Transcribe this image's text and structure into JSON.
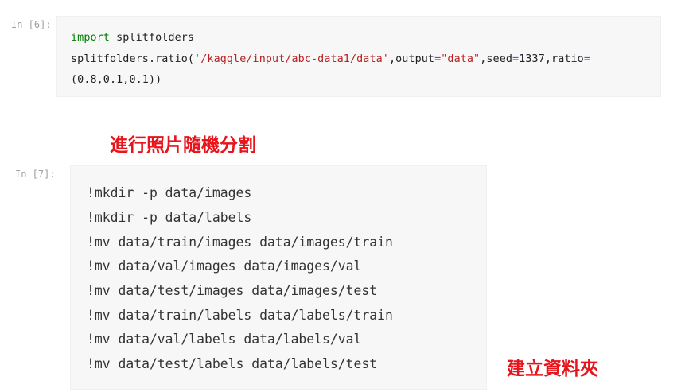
{
  "cells": [
    {
      "prompt": "In [6]:",
      "code": {
        "import_kw": "import",
        "import_module": " splitfolders",
        "call_prefix": "splitfolders.ratio(",
        "path_arg": "'/kaggle/input/abc-data1/data'",
        "output_kw": ",output",
        "eq1": "=",
        "output_val": "\"data\"",
        "seed_kw": ",seed",
        "eq2": "=",
        "seed_val": "1337",
        "ratio_kw": ",ratio",
        "eq3": "=",
        "ratio_val": "(0.8,0.1,0.1))"
      }
    },
    {
      "prompt": "In [7]:",
      "lines": [
        "!mkdir -p data/images",
        "!mkdir -p data/labels",
        "!mv data/train/images data/images/train",
        "!mv data/val/images data/images/val",
        "!mv data/test/images data/images/test",
        "!mv data/train/labels data/labels/train",
        "!mv data/val/labels data/labels/val",
        "!mv data/test/labels data/labels/test"
      ]
    }
  ],
  "annotations": {
    "split_note": "進行照片隨機分割",
    "folder_note": "建立資料夾"
  },
  "colors": {
    "annotation": "#e8141b",
    "keyword": "#008000",
    "string": "#ba2121",
    "operator": "#aa22ff",
    "cell_bg": "#f7f7f7",
    "prompt": "#9e9e9e"
  }
}
